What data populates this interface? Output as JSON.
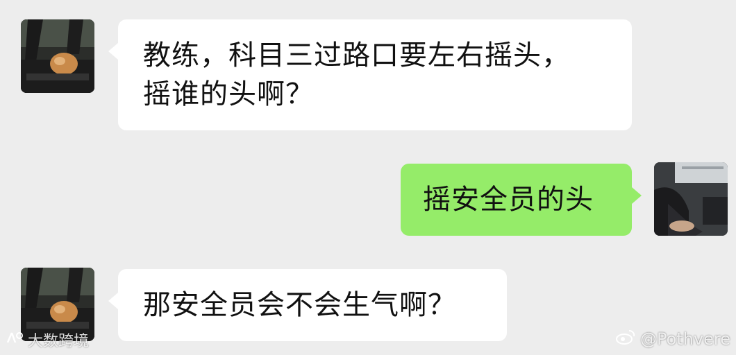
{
  "messages": [
    {
      "side": "in",
      "lines": [
        "教练，科目三过路口要左右摇头，",
        "摇谁的头啊？"
      ]
    },
    {
      "side": "out",
      "lines": [
        "摇安全员的头"
      ]
    },
    {
      "side": "in",
      "lines": [
        "那安全员会不会生气啊？"
      ]
    }
  ],
  "watermarks": {
    "left": "大数跨境",
    "right": "@Pothvere"
  },
  "avatars": {
    "contact": "cat-in-car-avatar",
    "self": "driver-avatar"
  },
  "colors": {
    "background": "#ededed",
    "incoming_bubble": "#ffffff",
    "outgoing_bubble": "#95ec69"
  }
}
